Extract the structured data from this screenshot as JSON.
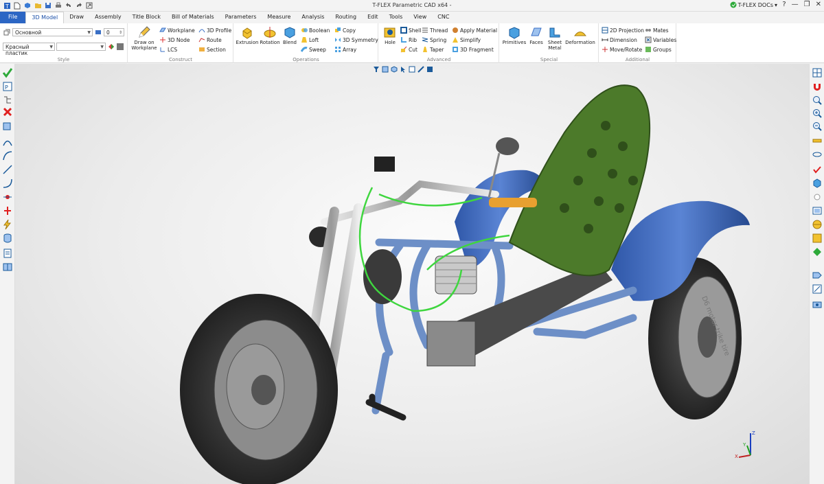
{
  "window": {
    "title": "T-FLEX Parametric CAD x64 -",
    "docs_label": "T-FLEX DOCs",
    "docs_dropdown": "▾",
    "controls": [
      "?",
      "—",
      "❐",
      "✕"
    ]
  },
  "tabs": [
    "File",
    "3D Model",
    "Draw",
    "Assembly",
    "Title Block",
    "Bill of Materials",
    "Parameters",
    "Measure",
    "Analysis",
    "Routing",
    "Edit",
    "Tools",
    "View",
    "CNC"
  ],
  "ribbon": {
    "style": {
      "label": "Style",
      "layer_value": "Основной",
      "level_value": "0",
      "material_value": "Красный пластик",
      "color_value": ""
    },
    "construct": {
      "label": "Construct",
      "draw_on_workplane": "Draw on Workplane",
      "workplane": "Workplane",
      "node": "3D Node",
      "lcs": "LCS",
      "profile": "3D Profile",
      "route": "Route",
      "section": "Section"
    },
    "operations": {
      "label": "Operations",
      "extrusion": "Extrusion",
      "rotation": "Rotation",
      "blend": "Blend",
      "boolean": "Boolean",
      "loft": "Loft",
      "sweep": "Sweep",
      "copy": "Copy",
      "symmetry": "3D Symmetry",
      "array": "Array"
    },
    "advanced": {
      "label": "Advanced",
      "hole": "Hole",
      "shell": "Shell",
      "rib": "Rib",
      "cut": "Cut",
      "thread": "Thread",
      "spring": "Spring",
      "taper": "Taper",
      "apply_material": "Apply Material",
      "simplify": "Simplify",
      "fragment": "3D Fragment"
    },
    "special": {
      "label": "Special",
      "primitives": "Primitives",
      "faces": "Faces",
      "sheet_metal": "Sheet Metal",
      "deformation": "Deformation"
    },
    "additional": {
      "label": "Additional",
      "projection": "2D Projection",
      "dimension": "Dimension",
      "move_rotate": "Move/Rotate",
      "mates": "Mates",
      "variables": "Variables",
      "groups": "Groups"
    }
  },
  "axes": {
    "x": "X",
    "y": "Y",
    "z": "Z"
  },
  "model": {
    "tire_text": "D6 motor trike tire",
    "colors": {
      "seat": "#4c7a2a",
      "fender": "#3e67b8",
      "wire": "#3fd63f",
      "frame": "#6d8fc7"
    }
  }
}
